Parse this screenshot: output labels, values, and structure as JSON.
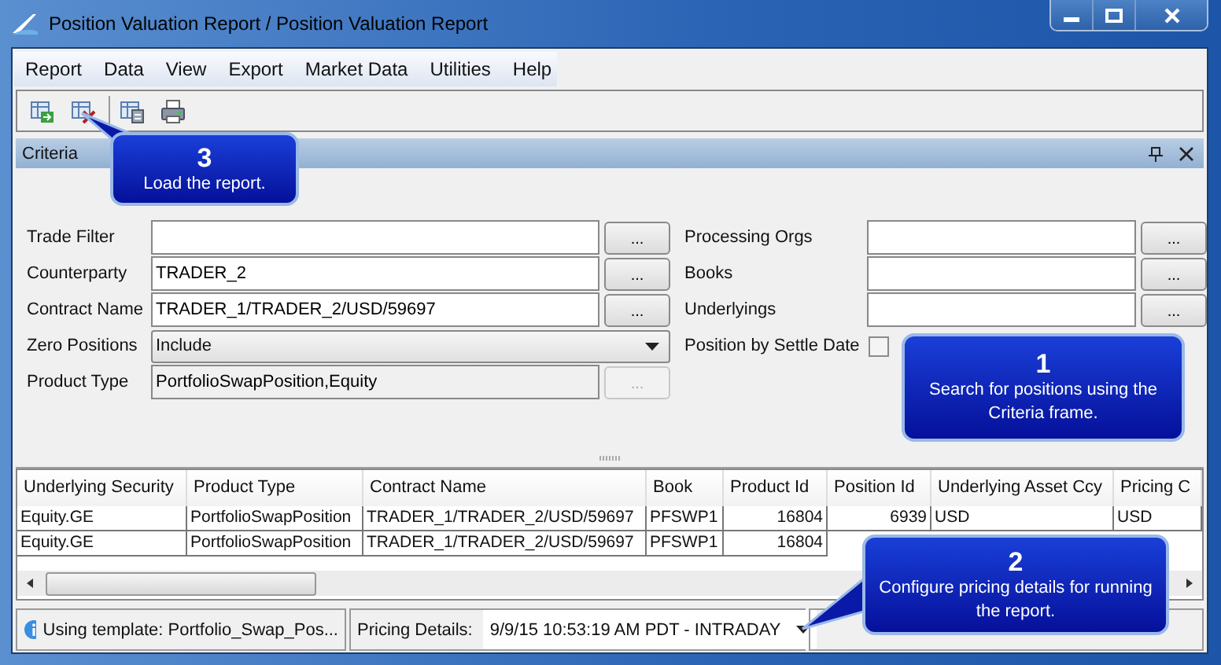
{
  "window": {
    "title": "Position Valuation Report / Position Valuation Report"
  },
  "menu": [
    "Report",
    "Data",
    "View",
    "Export",
    "Market Data",
    "Utilities",
    "Help"
  ],
  "toolbar": [
    {
      "kind": "load"
    },
    {
      "kind": "delete"
    },
    {
      "kind": "calc"
    },
    {
      "kind": "print"
    }
  ],
  "criteria": {
    "title": "Criteria",
    "left": [
      {
        "label": "Trade Filter",
        "kind": "text",
        "button": "..."
      },
      {
        "label": "Counterparty",
        "kind": "text",
        "value": "TRADER_2",
        "button": "..."
      },
      {
        "label": "Contract Name",
        "kind": "text",
        "value": "TRADER_1/TRADER_2/USD/59697",
        "button": "..."
      },
      {
        "label": "Zero Positions",
        "kind": "dropdown",
        "value": "Include"
      },
      {
        "label": "Product Type",
        "kind": "disabled",
        "value": "PortfolioSwapPosition,Equity",
        "button": "..."
      }
    ],
    "right": [
      {
        "label": "Processing Orgs",
        "kind": "text",
        "button": "..."
      },
      {
        "label": "Books",
        "kind": "text",
        "button": "..."
      },
      {
        "label": "Underlyings",
        "kind": "text",
        "button": "..."
      },
      {
        "label": "Position by Settle Date",
        "kind": "checkbox",
        "checked": false
      }
    ]
  },
  "table": {
    "columns": [
      "Underlying Security",
      "Product Type",
      "Contract Name",
      "Book",
      "Product Id",
      "Position Id",
      "Underlying Asset Ccy",
      "Pricing C"
    ],
    "rows": [
      [
        "Equity.GE",
        "PortfolioSwapPosition",
        "TRADER_1/TRADER_2/USD/59697",
        "PFSWP1",
        "16804",
        "6939",
        "USD",
        "USD"
      ],
      [
        "Equity.GE",
        "PortfolioSwapPosition",
        "TRADER_1/TRADER_2/USD/59697",
        "PFSWP1",
        "16804"
      ]
    ]
  },
  "status_bar": {
    "template": "Using template: Portfolio_Swap_Pos...",
    "pricing_label": "Pricing Details:",
    "pricing_value": "9/9/15 10:53:19 AM PDT - INTRADAY"
  },
  "callouts": [
    {
      "number": "3",
      "text": "Load the report.",
      "kind": "top-left"
    },
    {
      "number": "1",
      "text": "Search for positions using the Criteria frame.",
      "kind": "none"
    },
    {
      "number": "2",
      "text": "Configure pricing details for running the report.",
      "kind": "bottom-left"
    }
  ]
}
